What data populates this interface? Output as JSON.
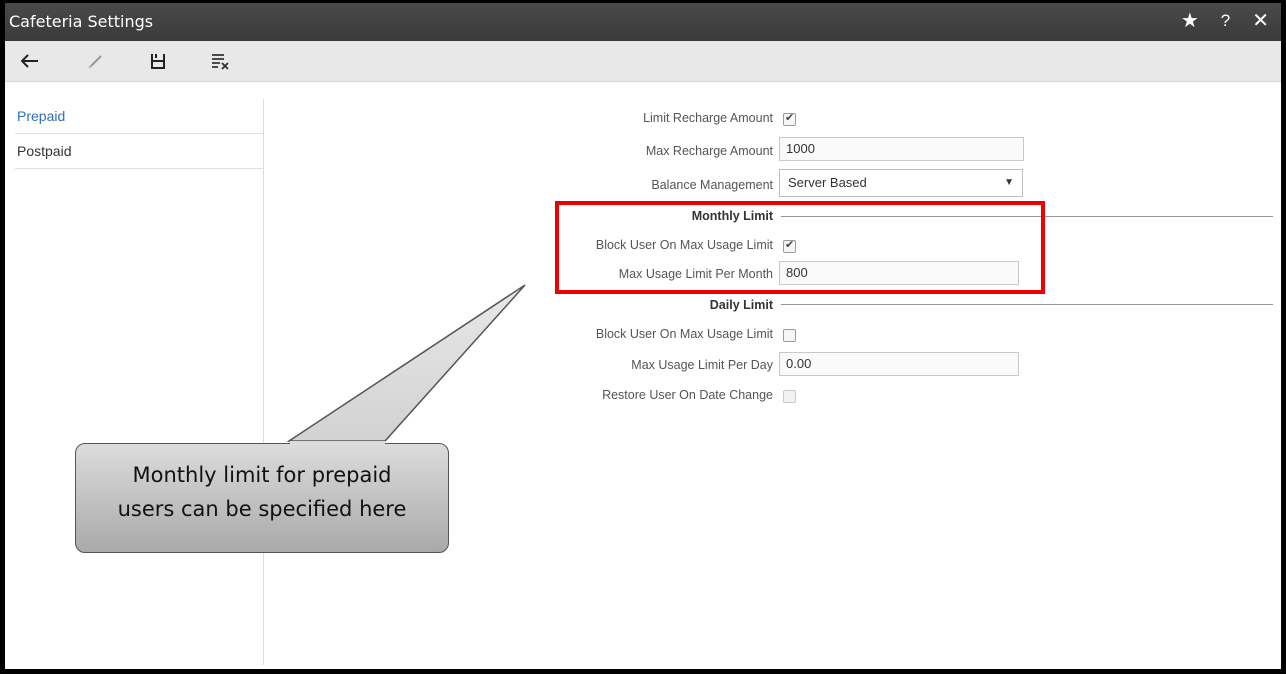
{
  "window": {
    "title": "Cafeteria Settings",
    "icons": [
      "star-icon",
      "help-icon",
      "close-icon"
    ]
  },
  "toolbar": {
    "icons": [
      "back-arrow-icon",
      "edit-icon",
      "save-icon",
      "clear-icon"
    ]
  },
  "sidebar": {
    "items": [
      {
        "label": "Prepaid",
        "active": true
      },
      {
        "label": "Postpaid",
        "active": false
      }
    ]
  },
  "form": {
    "limit_recharge_amount": {
      "label": "Limit Recharge Amount",
      "checked": true
    },
    "max_recharge_amount": {
      "label": "Max Recharge Amount",
      "value": "1000"
    },
    "balance_management": {
      "label": "Balance Management",
      "value": "Server Based"
    },
    "monthly_limit": {
      "heading": "Monthly Limit",
      "block_user": {
        "label": "Block User On Max Usage Limit",
        "checked": true
      },
      "max_usage": {
        "label": "Max Usage Limit Per Month",
        "value": "800"
      }
    },
    "daily_limit": {
      "heading": "Daily Limit",
      "block_user": {
        "label": "Block User On Max Usage Limit",
        "checked": false
      },
      "max_usage": {
        "label": "Max Usage Limit Per Day",
        "value": "0.00"
      },
      "restore_user": {
        "label": "Restore User On Date Change",
        "checked": false
      }
    }
  },
  "callout": {
    "line1": "Monthly limit for prepaid",
    "line2": "users can be specified here"
  },
  "colors": {
    "titlebar": "#3f3f3f",
    "active_link": "#2e6fbd",
    "highlight_box": "#e00000"
  }
}
